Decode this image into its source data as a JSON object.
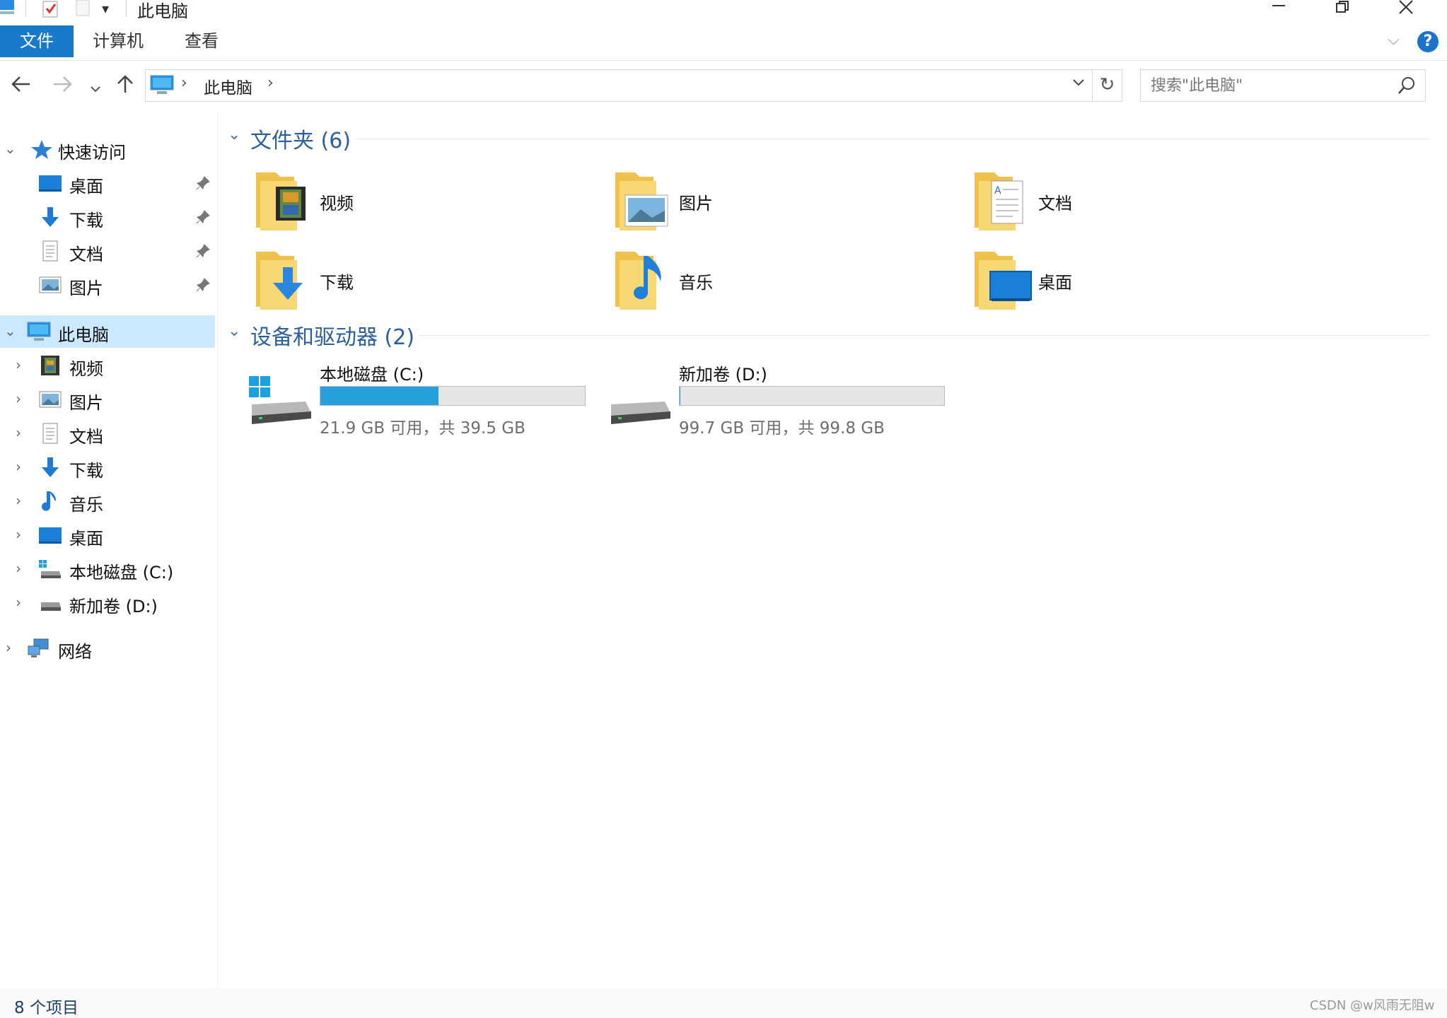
{
  "window": {
    "title": "此电脑",
    "minimize_icon": "minimize-icon",
    "restore_icon": "restore-icon",
    "close_icon": "close-icon"
  },
  "ribbon": {
    "tabs": [
      {
        "label": "文件",
        "active": true
      },
      {
        "label": "计算机",
        "active": false
      },
      {
        "label": "查看",
        "active": false
      }
    ],
    "accent_color": "#1979ca",
    "help_label": "?"
  },
  "address": {
    "breadcrumb": [
      "此电脑"
    ],
    "sep": "›"
  },
  "search": {
    "placeholder": "搜索\"此电脑\""
  },
  "sidebar": {
    "quick_access": {
      "label": "快速访问",
      "items": [
        {
          "label": "桌面",
          "icon": "desktop-icon",
          "pinned": true
        },
        {
          "label": "下载",
          "icon": "download-icon",
          "pinned": true
        },
        {
          "label": "文档",
          "icon": "document-icon",
          "pinned": true
        },
        {
          "label": "图片",
          "icon": "picture-icon",
          "pinned": true
        }
      ]
    },
    "this_pc": {
      "label": "此电脑",
      "items": [
        {
          "label": "视频",
          "icon": "video-icon"
        },
        {
          "label": "图片",
          "icon": "picture-icon"
        },
        {
          "label": "文档",
          "icon": "document-icon"
        },
        {
          "label": "下载",
          "icon": "download-icon"
        },
        {
          "label": "音乐",
          "icon": "music-icon"
        },
        {
          "label": "桌面",
          "icon": "desktop-icon"
        },
        {
          "label": "本地磁盘 (C:)",
          "icon": "system-drive-icon"
        },
        {
          "label": "新加卷 (D:)",
          "icon": "drive-icon"
        }
      ]
    },
    "network": {
      "label": "网络",
      "icon": "network-icon"
    },
    "selected_color": "#cce8ff"
  },
  "content": {
    "folders_group": {
      "title": "文件夹 (6)",
      "folders": [
        {
          "label": "视频",
          "icon": "video-folder-icon"
        },
        {
          "label": "图片",
          "icon": "pictures-folder-icon"
        },
        {
          "label": "文档",
          "icon": "documents-folder-icon"
        },
        {
          "label": "下载",
          "icon": "downloads-folder-icon"
        },
        {
          "label": "音乐",
          "icon": "music-folder-icon"
        },
        {
          "label": "桌面",
          "icon": "desktop-folder-icon"
        }
      ]
    },
    "drives_group": {
      "title": "设备和驱动器 (2)",
      "drives": [
        {
          "name": "本地磁盘 (C:)",
          "free_text": "21.9 GB 可用，共 39.5 GB",
          "used_fraction": 0.446,
          "icon": "system-drive-icon"
        },
        {
          "name": "新加卷 (D:)",
          "free_text": "99.7 GB 可用，共 99.8 GB",
          "used_fraction": 0.001,
          "icon": "drive-icon"
        }
      ]
    }
  },
  "status": {
    "item_count": "8 个项目",
    "watermark": "CSDN @w风雨无阻w"
  }
}
